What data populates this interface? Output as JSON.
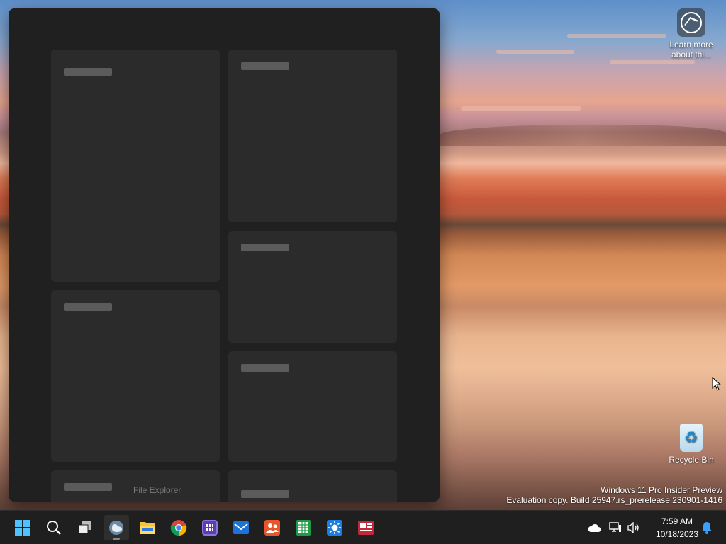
{
  "desktop": {
    "icons": [
      {
        "label": "Learn more about thi...",
        "icon": "learn-more-icon"
      },
      {
        "label": "Recycle Bin",
        "icon": "recycle-bin-icon"
      }
    ],
    "watermark": {
      "line1": "Windows 11 Pro Insider Preview",
      "line2": "Evaluation copy. Build 25947.rs_prerelease.230901-1416"
    }
  },
  "widgets": {
    "tooltip": "File Explorer"
  },
  "taskbar": {
    "apps": [
      {
        "name": "Start",
        "icon": "windows-logo-icon"
      },
      {
        "name": "Search",
        "icon": "search-icon"
      },
      {
        "name": "Task View",
        "icon": "task-view-icon"
      },
      {
        "name": "Widgets",
        "icon": "weather-widget-icon"
      },
      {
        "name": "File Explorer",
        "icon": "folder-icon"
      },
      {
        "name": "Chrome",
        "icon": "chrome-icon"
      },
      {
        "name": "Calendar",
        "icon": "calendar-icon"
      },
      {
        "name": "Mail",
        "icon": "mail-icon"
      },
      {
        "name": "People",
        "icon": "people-icon"
      },
      {
        "name": "Spreadsheet",
        "icon": "spreadsheet-icon"
      },
      {
        "name": "Weather",
        "icon": "sun-icon"
      },
      {
        "name": "News",
        "icon": "news-icon"
      }
    ],
    "tray_icons": [
      "onedrive-cloud-icon",
      "network-icon",
      "volume-icon",
      "notification-bell-icon"
    ],
    "time": "7:59 AM",
    "date": "10/18/2023"
  }
}
